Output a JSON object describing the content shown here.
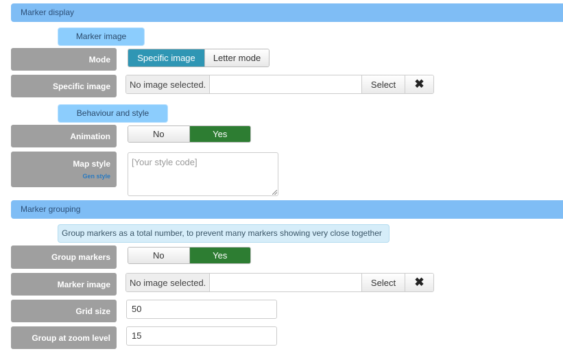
{
  "sections": {
    "marker_display": "Marker display",
    "marker_grouping": "Marker grouping"
  },
  "subheaders": {
    "marker_image": "Marker image",
    "behaviour_style": "Behaviour and style",
    "grouping_info": "Group markers as a total number, to prevent many markers showing very close together"
  },
  "mode": {
    "label": "Mode",
    "options": [
      "Specific image",
      "Letter mode"
    ],
    "selected": "Specific image"
  },
  "specific_image": {
    "label": "Specific image",
    "filename": "No image selected.",
    "select_label": "Select",
    "clear_icon": "✖"
  },
  "animation": {
    "label": "Animation",
    "no": "No",
    "yes": "Yes",
    "selected": "Yes"
  },
  "map_style": {
    "label": "Map style",
    "sublink": "Gen style",
    "placeholder": "[Your style code]"
  },
  "group_markers": {
    "label": "Group markers",
    "no": "No",
    "yes": "Yes",
    "selected": "Yes"
  },
  "marker_image": {
    "label": "Marker image",
    "filename": "No image selected.",
    "select_label": "Select",
    "clear_icon": "✖"
  },
  "grid_size": {
    "label": "Grid size",
    "value": "50"
  },
  "group_zoom": {
    "label": "Group at zoom level",
    "value": "15"
  },
  "colors": {
    "section_header": "#7fbdf5",
    "sub_badge": "#8ccdfd",
    "label_bg": "#9f9f9f",
    "selected_blue": "#2f96b4",
    "selected_green": "#2d7d32"
  }
}
